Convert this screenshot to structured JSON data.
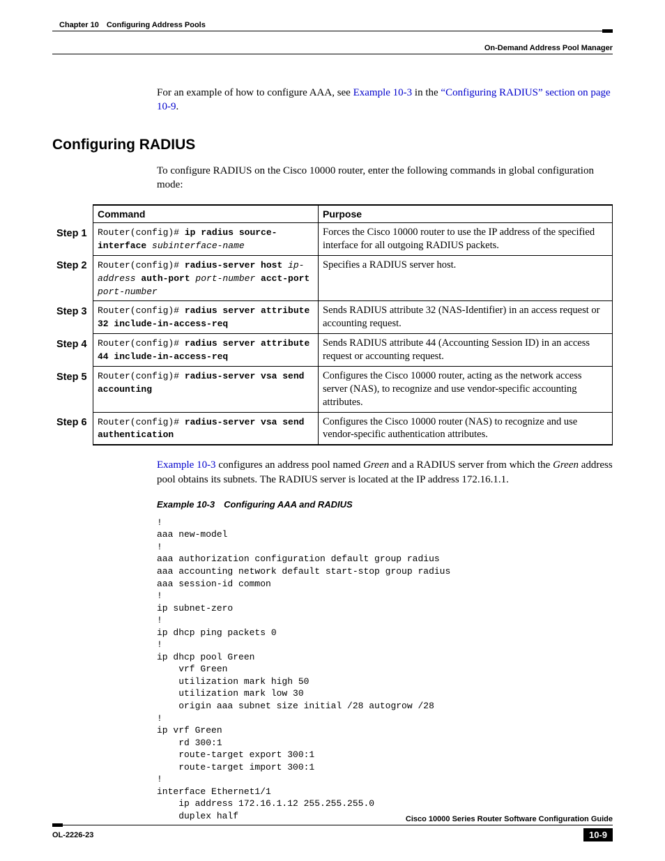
{
  "header": {
    "chapter": "Chapter 10 Configuring Address Pools",
    "section": "On-Demand Address Pool Manager"
  },
  "intro": {
    "pre": "For an example of how to configure AAA, see ",
    "link1": "Example 10-3",
    "mid": " in the ",
    "link2": "“Configuring RADIUS” section on page 10-9",
    "post": "."
  },
  "h2": "Configuring RADIUS",
  "lead": "To configure RADIUS on the Cisco 10000 router, enter the following commands in global configuration mode:",
  "table": {
    "col1": "Command",
    "col2": "Purpose",
    "rows": [
      {
        "step": "Step 1",
        "cmd_pre": "Router(config)# ",
        "cmd_bold1": "ip radius source-interface",
        "cmd_ital1": " subinterface-name",
        "cmd_bold2": "",
        "cmd_ital2": "",
        "cmd_bold3": "",
        "cmd_ital3": "",
        "purpose": "Forces the Cisco 10000 router to use the IP address of the specified interface for all outgoing RADIUS packets."
      },
      {
        "step": "Step 2",
        "cmd_pre": "Router(config)# ",
        "cmd_bold1": "radius-server host",
        "cmd_ital1": " ip-address",
        "cmd_bold2": " auth-port",
        "cmd_ital2": " port-number",
        "cmd_bold3": " acct-port",
        "cmd_ital3": " port-number",
        "purpose": "Specifies a RADIUS server host."
      },
      {
        "step": "Step 3",
        "cmd_pre": "Router(config)# ",
        "cmd_bold1": "radius server attribute 32 include-in-access-req",
        "cmd_ital1": "",
        "cmd_bold2": "",
        "cmd_ital2": "",
        "cmd_bold3": "",
        "cmd_ital3": "",
        "purpose": "Sends RADIUS attribute 32 (NAS-Identifier) in an access request or accounting request."
      },
      {
        "step": "Step 4",
        "cmd_pre": "Router(config)# ",
        "cmd_bold1": "radius server attribute 44 include-in-access-req",
        "cmd_ital1": "",
        "cmd_bold2": "",
        "cmd_ital2": "",
        "cmd_bold3": "",
        "cmd_ital3": "",
        "purpose": "Sends RADIUS attribute 44 (Accounting Session ID) in an access request or accounting request."
      },
      {
        "step": "Step 5",
        "cmd_pre": "Router(config)# ",
        "cmd_bold1": "radius-server vsa send accounting",
        "cmd_ital1": "",
        "cmd_bold2": "",
        "cmd_ital2": "",
        "cmd_bold3": "",
        "cmd_ital3": "",
        "purpose": "Configures the Cisco 10000 router, acting as the network access server (NAS), to recognize and use vendor-specific accounting attributes."
      },
      {
        "step": "Step 6",
        "cmd_pre": "Router(config)# ",
        "cmd_bold1": "radius-server vsa send authentication",
        "cmd_ital1": "",
        "cmd_bold2": "",
        "cmd_ital2": "",
        "cmd_bold3": "",
        "cmd_ital3": "",
        "purpose": "Configures the Cisco 10000 router (NAS) to recognize and use vendor-specific authentication attributes."
      }
    ]
  },
  "after_table": {
    "link": "Example 10-3",
    "t1": " configures an address pool named ",
    "i1": "Green",
    "t2": " and a RADIUS server from which the ",
    "i2": "Green",
    "t3": " address pool obtains its subnets. The RADIUS server is located at the IP address 172.16.1.1."
  },
  "example_title": "Example 10-3 Configuring AAA and RADIUS",
  "listing": "!\naaa new-model\n!\naaa authorization configuration default group radius\naaa accounting network default start-stop group radius\naaa session-id common\n!\nip subnet-zero\n!\nip dhcp ping packets 0\n!\nip dhcp pool Green\n    vrf Green\n    utilization mark high 50\n    utilization mark low 30\n    origin aaa subnet size initial /28 autogrow /28\n!\nip vrf Green\n    rd 300:1\n    route-target export 300:1\n    route-target import 300:1\n!\ninterface Ethernet1/1\n    ip address 172.16.1.12 255.255.255.0\n    duplex half",
  "footer": {
    "guide": "Cisco 10000 Series Router Software Configuration Guide",
    "doc": "OL-2226-23",
    "page": "10-9"
  }
}
